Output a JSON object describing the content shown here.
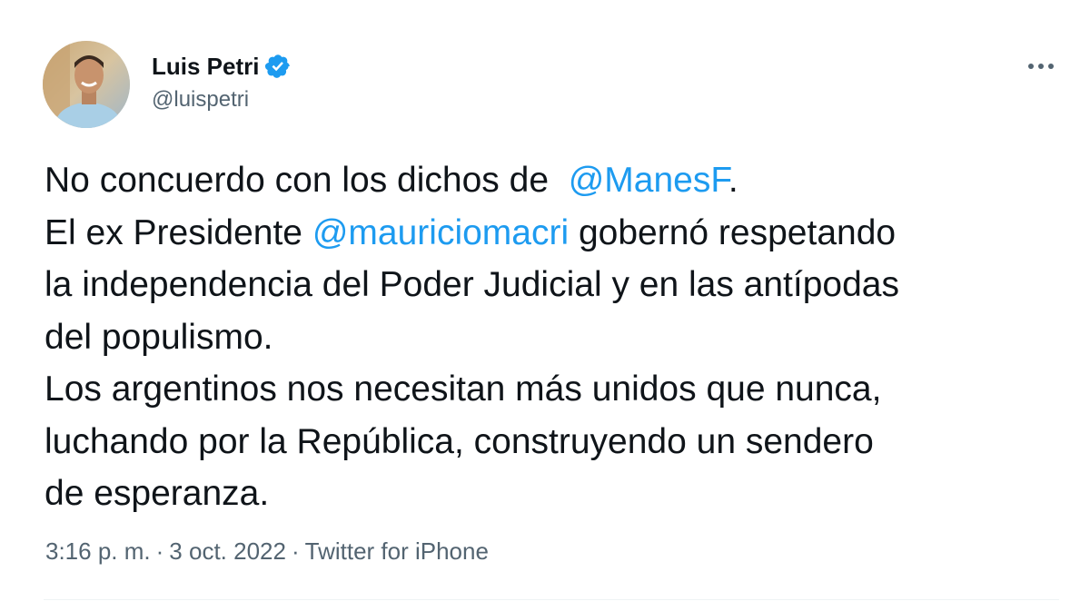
{
  "author": {
    "display_name": "Luis Petri",
    "handle": "@luispetri",
    "avatar": "profile-photo",
    "verified_icon": "verified-badge-icon"
  },
  "tweet": {
    "lines": [
      [
        {
          "text": "No concuerdo con los dichos de  ",
          "type": "text"
        },
        {
          "text": "@ManesF",
          "type": "mention"
        },
        {
          "text": ".",
          "type": "text"
        }
      ],
      [
        {
          "text": "El ex Presidente ",
          "type": "text"
        },
        {
          "text": "@mauriciomacri",
          "type": "mention"
        },
        {
          "text": " gobernó respetando",
          "type": "text"
        }
      ],
      [
        {
          "text": "la independencia del Poder Judicial y en las antípodas",
          "type": "text"
        }
      ],
      [
        {
          "text": "del populismo.",
          "type": "text"
        }
      ],
      [
        {
          "text": "Los argentinos nos necesitan más unidos que nunca,",
          "type": "text"
        }
      ],
      [
        {
          "text": "luchando por la República, construyendo un sendero",
          "type": "text"
        }
      ],
      [
        {
          "text": "de esperanza.",
          "type": "text"
        }
      ]
    ]
  },
  "meta": {
    "time": "3:16 p. m.",
    "separator": "·",
    "date": "3 oct. 2022",
    "source": "Twitter for iPhone"
  },
  "icons": {
    "more": "more-options-icon"
  },
  "colors": {
    "link": "#1d9bf0",
    "text": "#0f1419",
    "secondary": "#536471",
    "verified": "#1d9bf0"
  }
}
